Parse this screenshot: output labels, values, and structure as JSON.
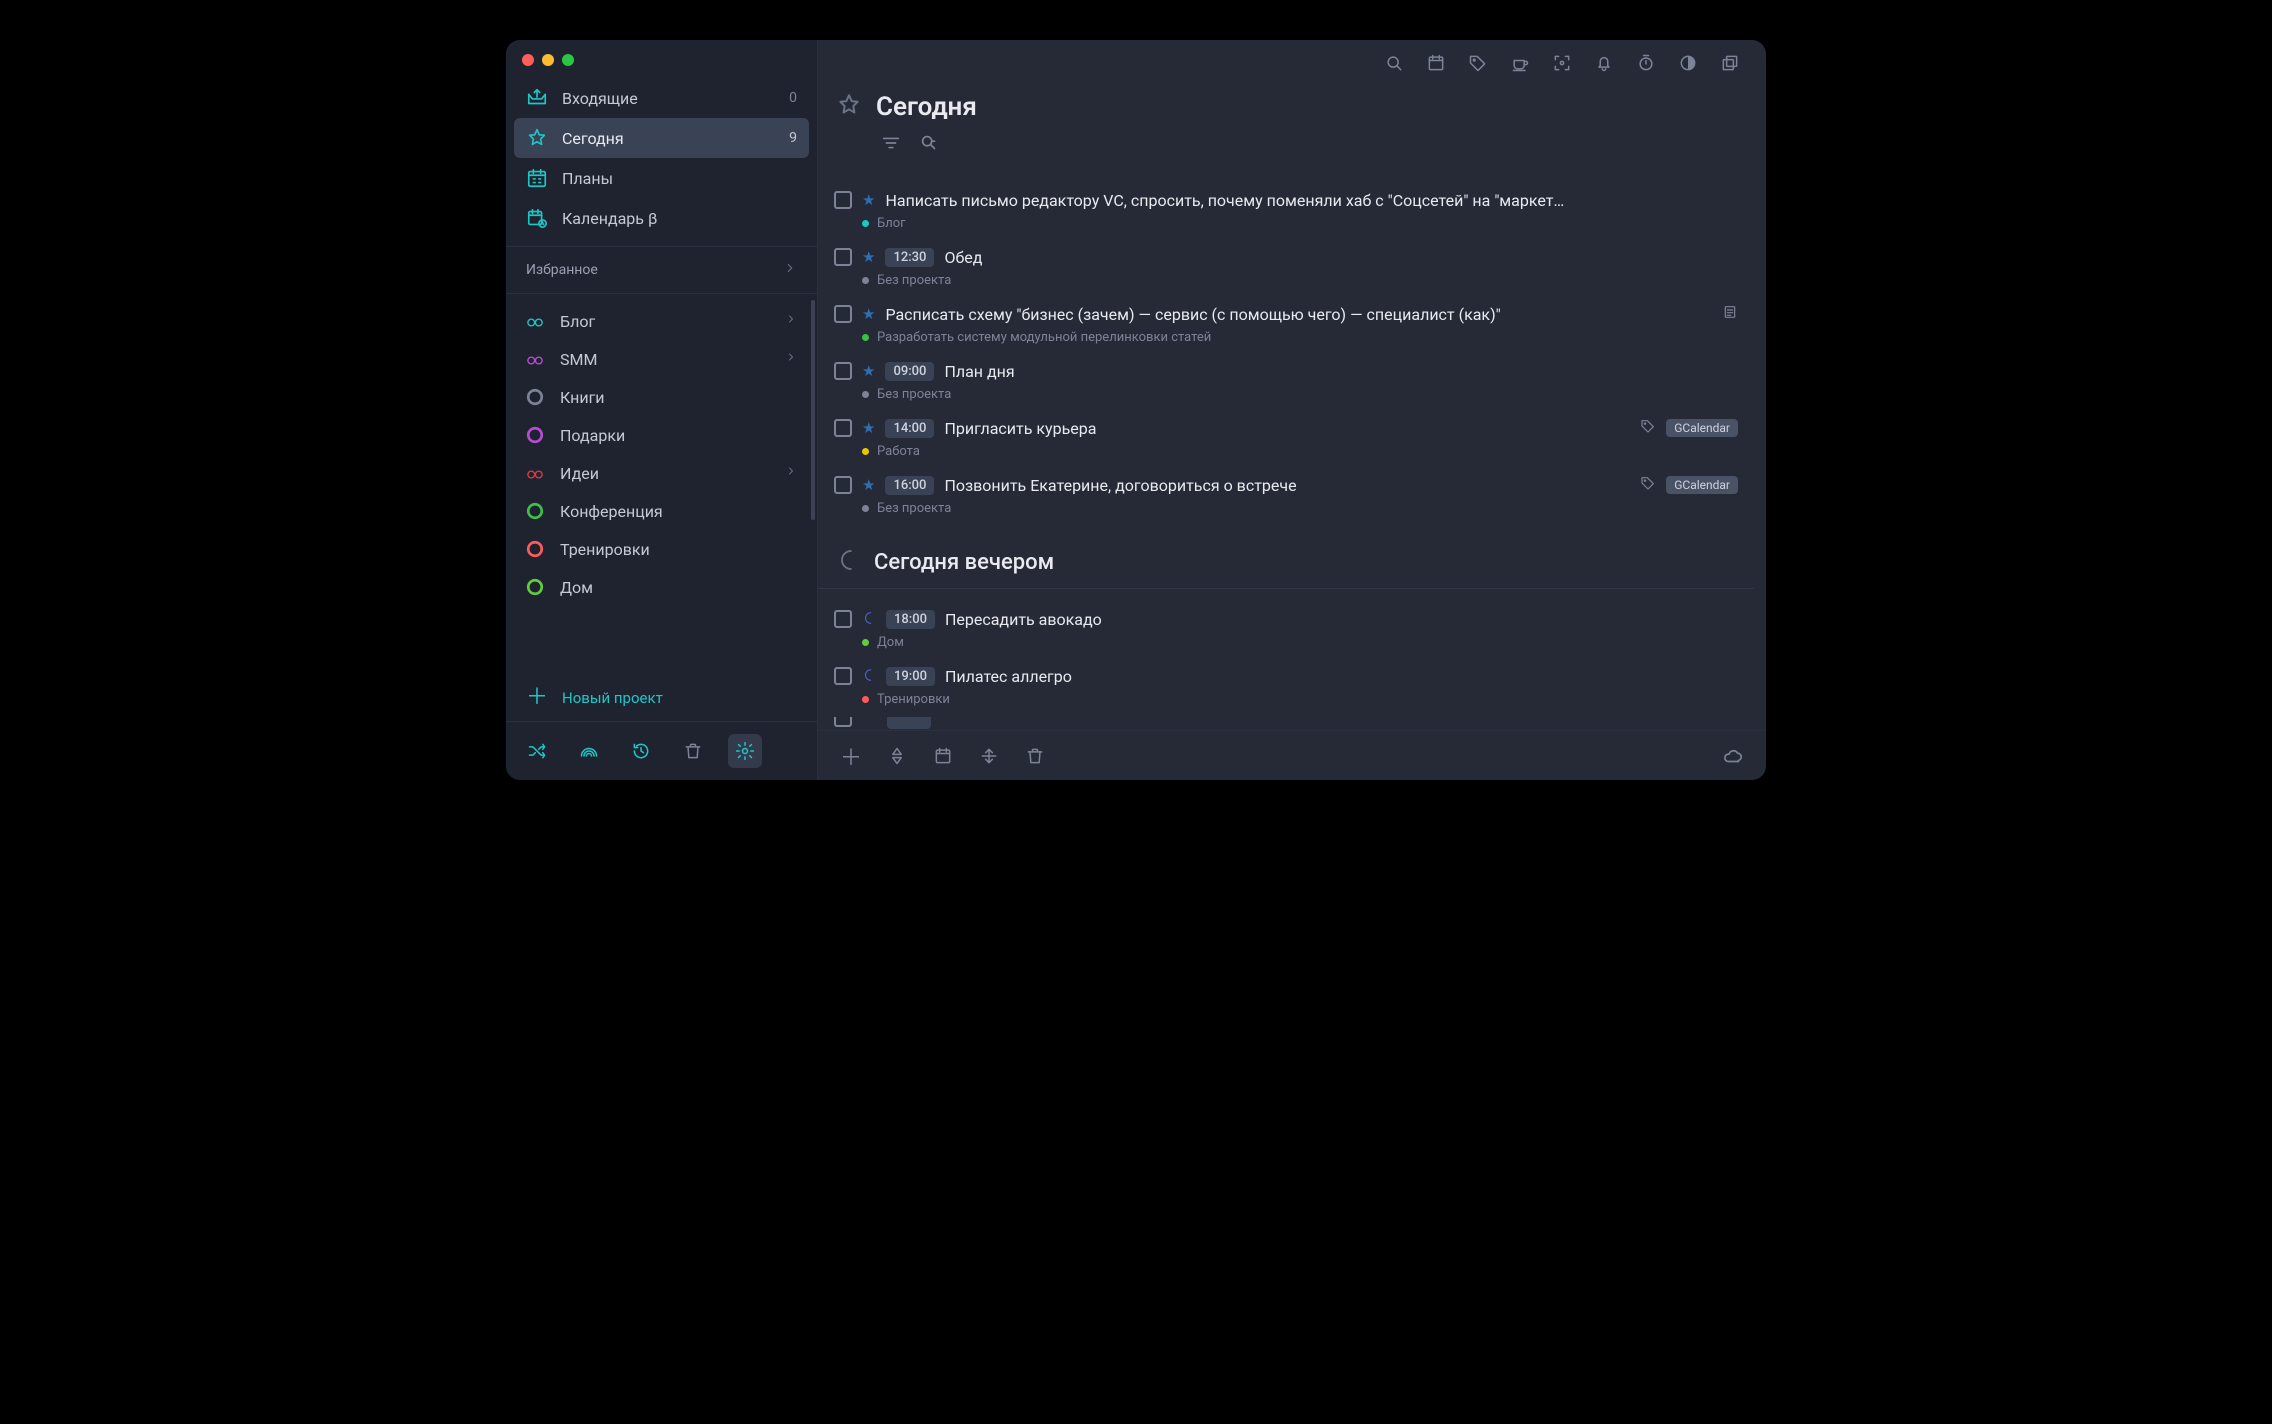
{
  "nav": {
    "inbox": {
      "label": "Входящие",
      "count": "0"
    },
    "today": {
      "label": "Сегодня",
      "count": "9"
    },
    "plans": {
      "label": "Планы"
    },
    "calendar": {
      "label": "Календарь β"
    }
  },
  "favorites_label": "Избранное",
  "projects": [
    {
      "label": "Блог",
      "color": "#1ec7c7",
      "kind": "double",
      "expandable": true
    },
    {
      "label": "SMM",
      "color": "#b84bd4",
      "kind": "double",
      "expandable": true
    },
    {
      "label": "Книги",
      "color": "#7d8396",
      "kind": "ring",
      "expandable": false
    },
    {
      "label": "Подарки",
      "color": "#b84bd4",
      "kind": "ring",
      "expandable": false
    },
    {
      "label": "Идеи",
      "color": "#e03b3b",
      "kind": "double",
      "expandable": true
    },
    {
      "label": "Конференция",
      "color": "#3cc04a",
      "kind": "ring",
      "expandable": false
    },
    {
      "label": "Тренировки",
      "color": "#ff5b5b",
      "kind": "ring",
      "expandable": false
    },
    {
      "label": "Дом",
      "color": "#5fce3a",
      "kind": "ring",
      "expandable": false
    }
  ],
  "new_project_label": "Новый проект",
  "view_title": "Сегодня",
  "evening_title": "Сегодня вечером",
  "tasks_today": [
    {
      "title": "Написать письмо редактору VC, спросить, почему поменяли хаб с \"Соцсетей\" на \"маркет…",
      "time": null,
      "project": "Блог",
      "dot": "#1ec7c7",
      "tag": null,
      "note": false
    },
    {
      "title": "Обед",
      "time": "12:30",
      "project": "Без проекта",
      "dot": "#7d8396",
      "tag": null,
      "note": false
    },
    {
      "title": "Расписать схему \"бизнес (зачем) — сервис (с помощью чего) — специалист (как)\"",
      "time": null,
      "project": "Разработать систему модульной перелинковки статей",
      "dot": "#3cc04a",
      "tag": null,
      "note": true
    },
    {
      "title": "План дня",
      "time": "09:00",
      "project": "Без проекта",
      "dot": "#7d8396",
      "tag": null,
      "note": false
    },
    {
      "title": "Пригласить курьера",
      "time": "14:00",
      "project": "Работа",
      "dot": "#e8c40b",
      "tag": "GCalendar",
      "note": false
    },
    {
      "title": "Позвонить Екатерине, договориться о встрече",
      "time": "16:00",
      "project": "Без проекта",
      "dot": "#7d8396",
      "tag": "GCalendar",
      "note": false
    }
  ],
  "tasks_evening": [
    {
      "title": "Пересадить авокадо",
      "time": "18:00",
      "project": "Дом",
      "dot": "#5fce3a"
    },
    {
      "title": "Пилатес аллегро",
      "time": "19:00",
      "project": "Тренировки",
      "dot": "#ff5b5b"
    }
  ]
}
